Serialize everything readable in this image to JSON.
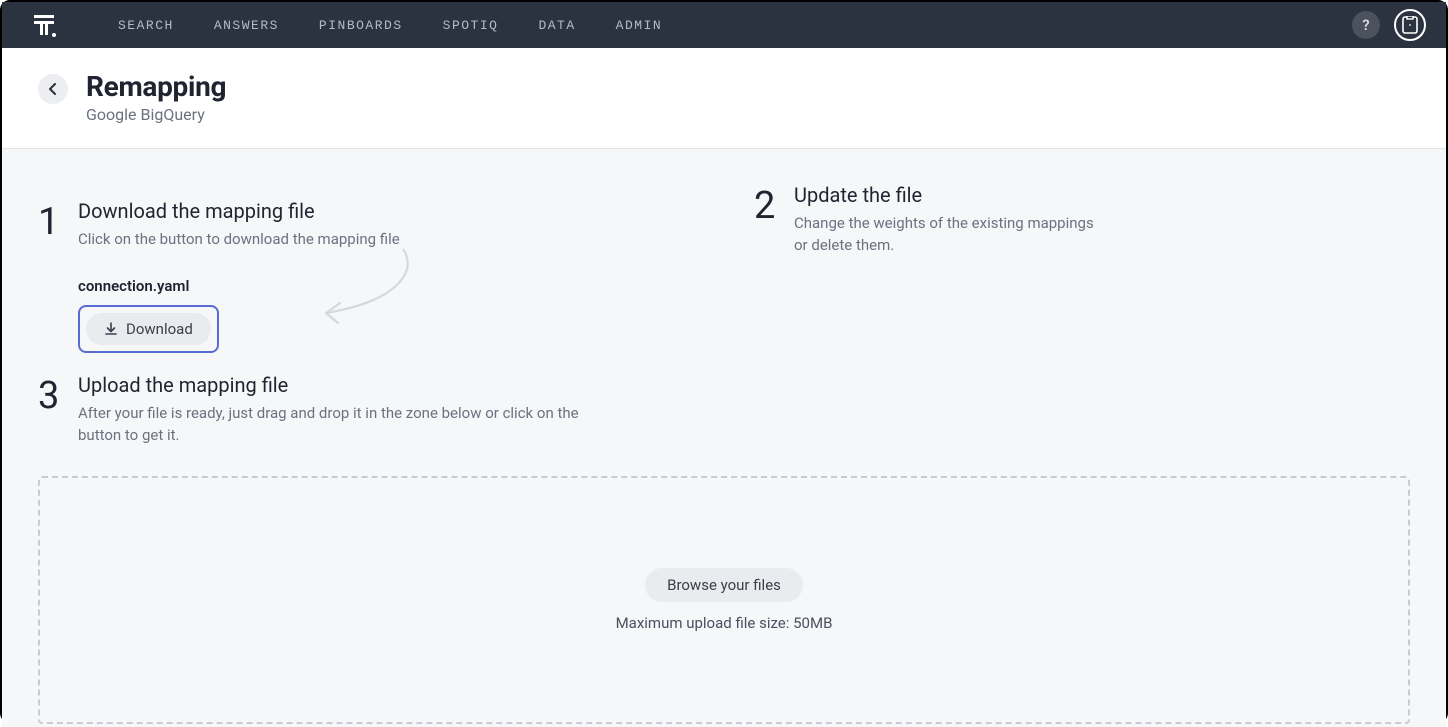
{
  "nav": {
    "links": [
      "SEARCH",
      "ANSWERS",
      "PINBOARDS",
      "SPOTIQ",
      "DATA",
      "ADMIN"
    ],
    "help": "?"
  },
  "header": {
    "title": "Remapping",
    "subtitle": "Google BigQuery"
  },
  "steps": {
    "s1": {
      "num": "1",
      "title": "Download the mapping file",
      "desc": "Click on the button to download the mapping file",
      "filename": "connection.yaml",
      "download_label": "Download"
    },
    "s2": {
      "num": "2",
      "title": "Update the file",
      "desc": "Change the weights of the existing mappings or delete them."
    },
    "s3": {
      "num": "3",
      "title": "Upload the mapping file",
      "desc": "After your file is ready, just drag and drop it in the zone below or click on the button to get it."
    }
  },
  "dropzone": {
    "browse_label": "Browse your files",
    "max_size_text": "Maximum upload file size: 50MB"
  }
}
